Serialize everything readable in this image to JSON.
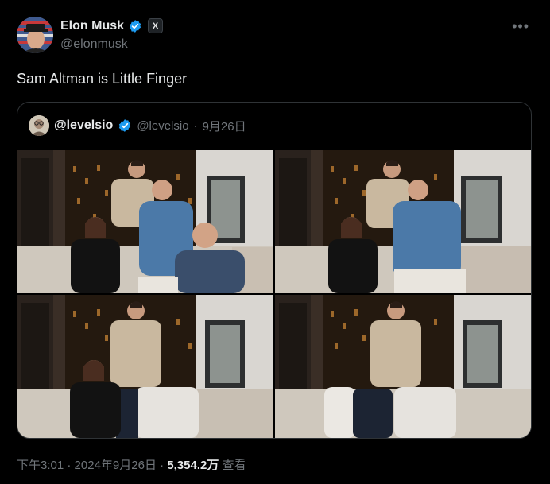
{
  "post": {
    "author_name": "Elon Musk",
    "author_handle": "@elonmusk",
    "verified_icon": "verified-badge-icon",
    "affiliate_badge": "X",
    "more_icon": "more-options-icon",
    "text": "Sam Altman is Little Finger",
    "meta": {
      "time": "下午3:01",
      "date": "2024年9月26日",
      "separator": "·",
      "views_count": "5,354.2万",
      "views_label": "查看"
    }
  },
  "quoted": {
    "author_name": "@levelsio",
    "author_handle": "@levelsio",
    "separator": "·",
    "date": "9月26日"
  },
  "colors": {
    "background": "#000000",
    "text_primary": "#e7e9ea",
    "text_secondary": "#71767b",
    "border": "#2f3336",
    "verified_blue": "#1d9bf0"
  }
}
